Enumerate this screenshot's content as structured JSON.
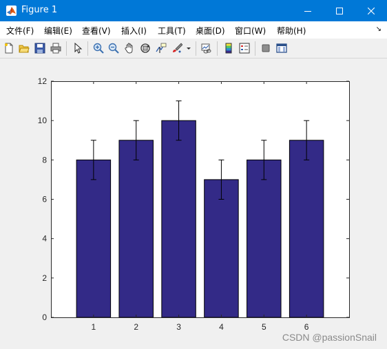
{
  "window": {
    "title": "Figure 1"
  },
  "menu": {
    "items": [
      {
        "label": "文件(F)"
      },
      {
        "label": "编辑(E)"
      },
      {
        "label": "查看(V)"
      },
      {
        "label": "插入(I)"
      },
      {
        "label": "工具(T)"
      },
      {
        "label": "桌面(D)"
      },
      {
        "label": "窗口(W)"
      },
      {
        "label": "帮助(H)"
      }
    ],
    "overflow_glyph": "↘"
  },
  "toolbar": {
    "icons": [
      "new-figure-icon",
      "open-file-icon",
      "save-icon",
      "print-icon",
      "pointer-icon",
      "zoom-in-icon",
      "zoom-out-icon",
      "pan-hand-icon",
      "rotate-3d-icon",
      "data-cursor-icon",
      "brush-icon",
      "link-plot-icon",
      "colorbar-icon",
      "legend-icon",
      "hide-plot-tools-icon",
      "show-plot-tools-icon"
    ]
  },
  "watermark": "CSDN @passionSnail",
  "colors": {
    "titlebar": "#0078d7",
    "bar_fill": "#332a87",
    "plot_bg": "#ffffff"
  },
  "chart_data": {
    "type": "bar",
    "categories": [
      "1",
      "2",
      "3",
      "4",
      "5",
      "6"
    ],
    "values": [
      8,
      9,
      10,
      7,
      8,
      9
    ],
    "error": [
      1,
      1,
      1,
      1,
      1,
      1
    ],
    "ylim": [
      0,
      12
    ],
    "yticks": [
      0,
      2,
      4,
      6,
      8,
      10,
      12
    ],
    "xlabel": "",
    "ylabel": "",
    "title": "",
    "grid": false
  }
}
